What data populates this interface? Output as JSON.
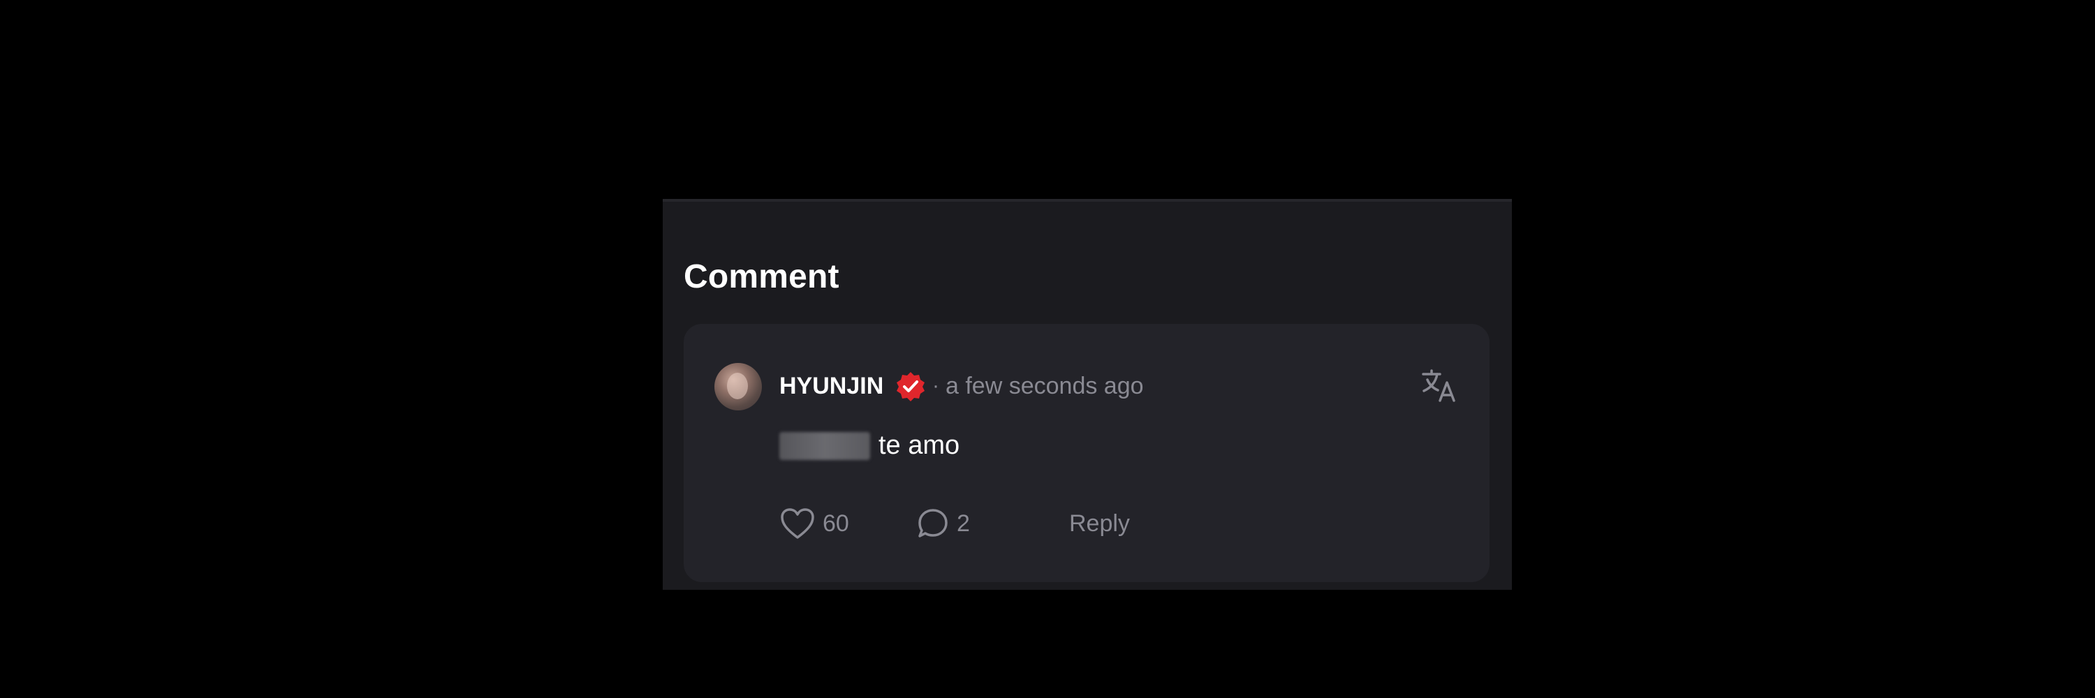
{
  "panel": {
    "title": "Comment"
  },
  "comment": {
    "username": "HYUNJIN",
    "separator": "·",
    "timestamp": "a few seconds ago",
    "text": "te amo",
    "likes": "60",
    "replies": "2",
    "reply_label": "Reply",
    "icons": {
      "avatar": "avatar",
      "verified": "verified-badge-icon",
      "translate": "translate-icon",
      "like": "heart-icon",
      "replies": "speech-bubble-icon"
    },
    "colors": {
      "verified": "#e0262c",
      "muted_text": "#8a8a93",
      "card_bg": "#232329",
      "panel_bg": "#1b1b1f"
    }
  }
}
